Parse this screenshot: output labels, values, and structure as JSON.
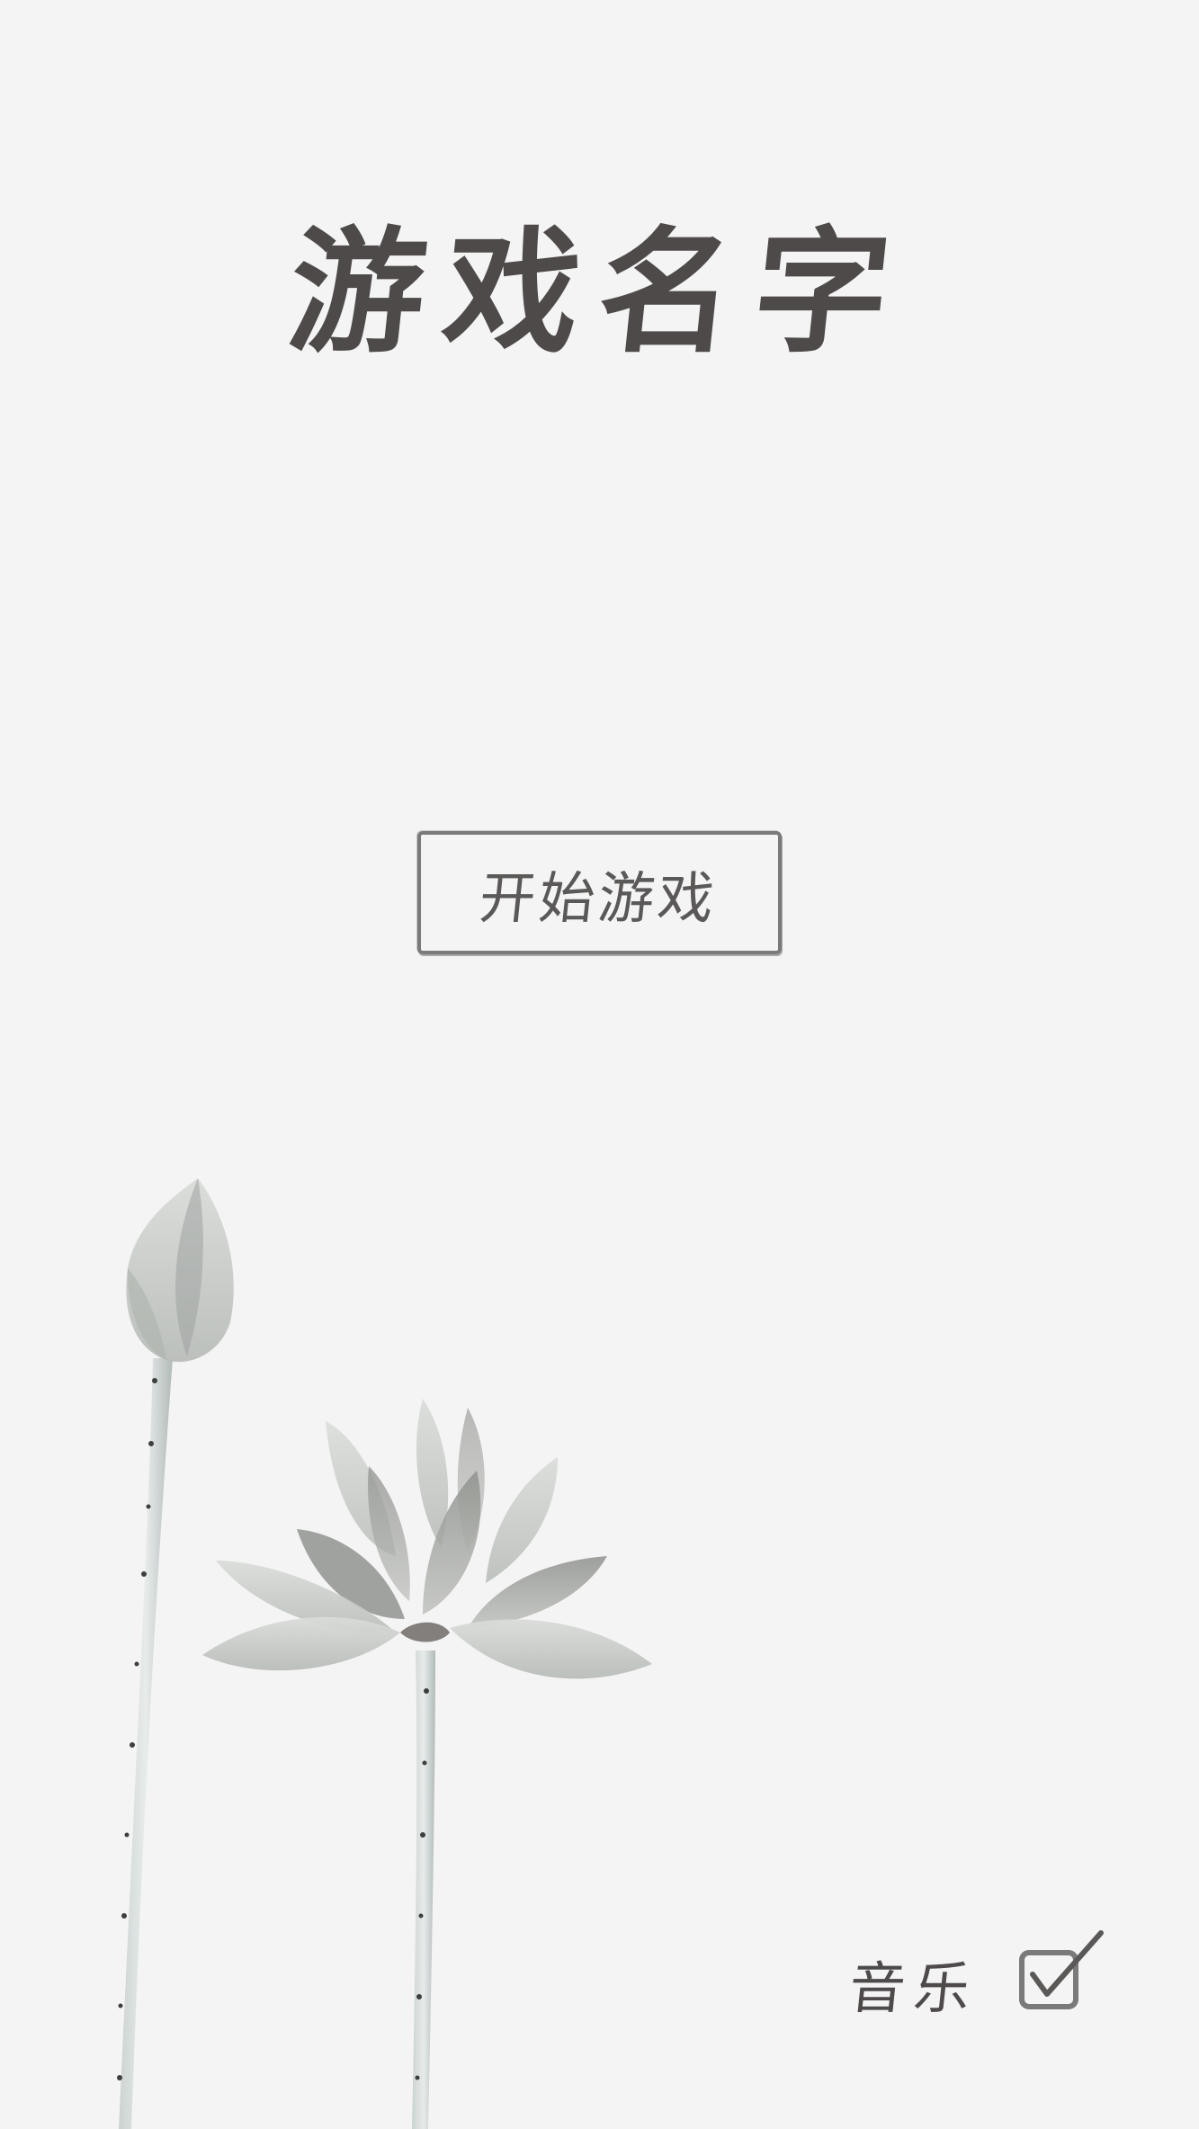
{
  "title": "游戏名字",
  "start_button": {
    "label": "开始游戏"
  },
  "music": {
    "label": "音乐",
    "checked": true,
    "icon": "checkbox-checked-icon"
  },
  "decoration": {
    "icon": "lotus-ink-painting",
    "palette": {
      "ink": "#4e4a4a",
      "petal": "#c9ccc9",
      "stem": "#aeb8b6",
      "background": "#f4f4f4"
    }
  }
}
